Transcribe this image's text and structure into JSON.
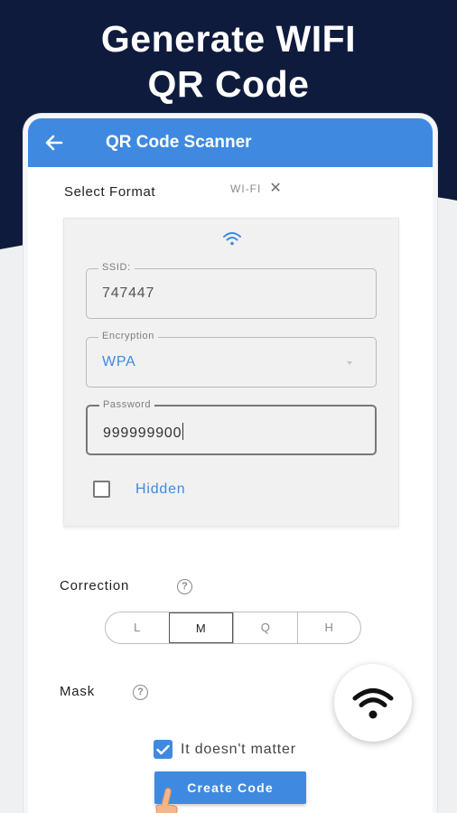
{
  "promo": {
    "headline_line1": "Generate WIFI",
    "headline_line2": "QR Code",
    "navy_color": "#0f1b3d"
  },
  "appbar": {
    "title": "QR Code Scanner",
    "back_icon": "arrow-left-icon",
    "color": "#3f8ae0"
  },
  "format": {
    "label": "Select Format",
    "chip_value": "WI-FI",
    "chip_close_icon": "close-icon"
  },
  "wifi_form": {
    "header_icon": "wifi-icon",
    "ssid": {
      "label": "SSID:",
      "value": "747447"
    },
    "encryption": {
      "label": "Encryption",
      "value": "WPA"
    },
    "password": {
      "label": "Password",
      "value": "999999900"
    },
    "hidden": {
      "label": "Hidden",
      "checked": false
    }
  },
  "correction": {
    "label": "Correction",
    "help_icon": "question-icon",
    "options": [
      "L",
      "M",
      "Q",
      "H"
    ],
    "selected": "M"
  },
  "mask": {
    "label": "Mask",
    "help_icon": "question-icon"
  },
  "options": {
    "doesnt_matter_label": "It doesn't matter",
    "doesnt_matter_checked": true
  },
  "actions": {
    "create_label": "Create Code"
  },
  "fab": {
    "icon": "wifi-icon"
  }
}
